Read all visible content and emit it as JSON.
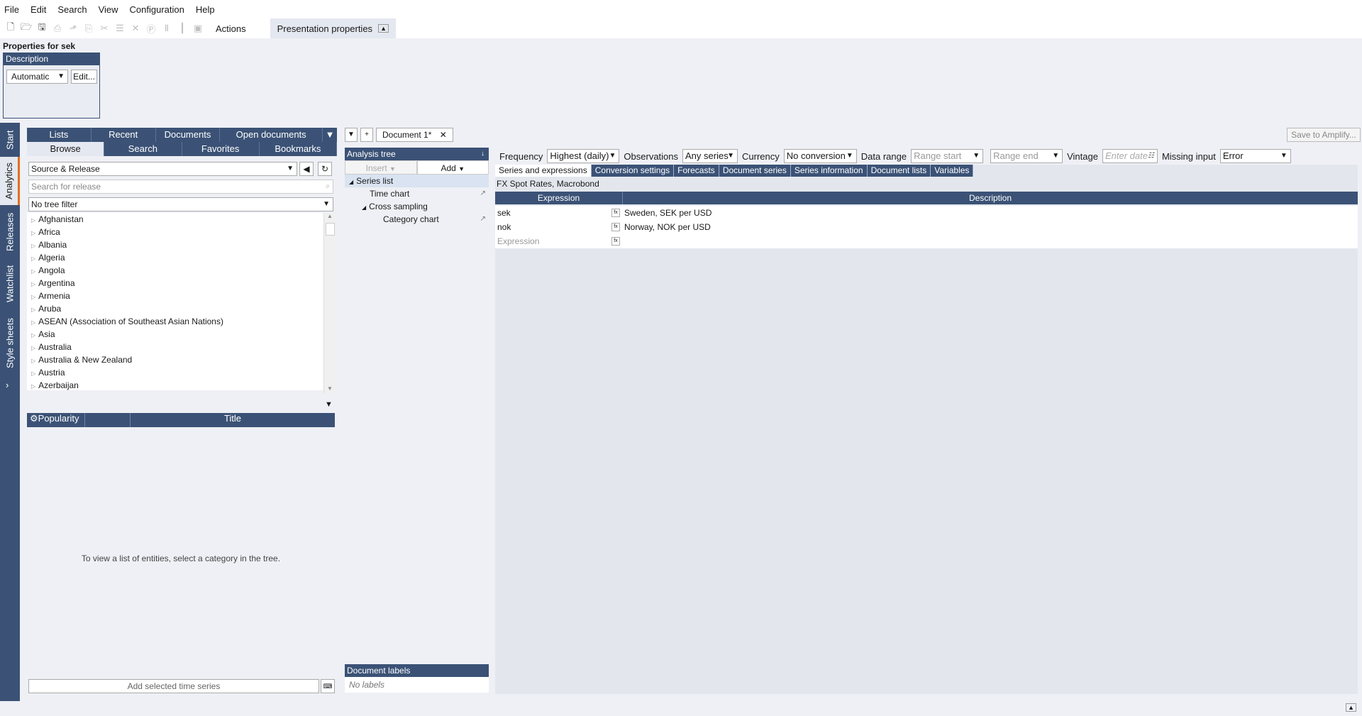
{
  "menu": [
    "File",
    "Edit",
    "Search",
    "View",
    "Configuration",
    "Help"
  ],
  "toolbar": {
    "actions_label": "Actions",
    "presentation_tab": "Presentation properties"
  },
  "properties": {
    "title": "Properties for sek",
    "description_header": "Description",
    "description_value": "Automatic",
    "edit_label": "Edit..."
  },
  "side_tabs": [
    "Start",
    "Analytics",
    "Releases",
    "Watchlist",
    "Style sheets"
  ],
  "browse": {
    "tabs_row1": [
      "Lists",
      "Recent",
      "Documents",
      "Open documents"
    ],
    "tabs_row2": [
      "Browse",
      "Search",
      "Favorites",
      "Bookmarks"
    ],
    "source_select": "Source & Release",
    "search_placeholder": "Search for release",
    "tree_filter": "No tree filter",
    "tree_items": [
      "Afghanistan",
      "Africa",
      "Albania",
      "Algeria",
      "Angola",
      "Argentina",
      "Armenia",
      "Aruba",
      "ASEAN (Association of Southeast Asian Nations)",
      "Asia",
      "Australia",
      "Australia & New Zealand",
      "Austria",
      "Azerbaijan"
    ],
    "grid_columns": [
      "Popularity",
      "",
      "Title"
    ],
    "empty_message": "To view a list of entities, select a category in the tree.",
    "add_selected": "Add selected time series"
  },
  "document": {
    "tab_label": "Document 1*",
    "save_amplify": "Save to Amplify..."
  },
  "analysis_tree": {
    "header": "Analysis tree",
    "insert_label": "Insert",
    "add_label": "Add",
    "items": [
      {
        "label": "Series list",
        "indent": 0
      },
      {
        "label": "Time chart",
        "indent": 1
      },
      {
        "label": "Cross sampling",
        "indent": 1
      },
      {
        "label": "Category chart",
        "indent": 2
      }
    ],
    "doc_labels_header": "Document labels",
    "doc_labels_empty": "No labels"
  },
  "options": {
    "frequency_label": "Frequency",
    "frequency_value": "Highest (daily)",
    "observations_label": "Observations",
    "observations_value": "Any series",
    "currency_label": "Currency",
    "currency_value": "No conversion",
    "data_range_label": "Data range",
    "range_start": "Range start",
    "range_end": "Range end",
    "vintage_label": "Vintage",
    "vintage_placeholder": "Enter date",
    "missing_label": "Missing input",
    "missing_value": "Error"
  },
  "sub_tabs": [
    "Series and expressions",
    "Conversion settings",
    "Forecasts",
    "Document series",
    "Series information",
    "Document lists",
    "Variables"
  ],
  "dataset_title": "FX Spot Rates, Macrobond",
  "expressions": {
    "columns": [
      "Expression",
      "Description"
    ],
    "rows": [
      {
        "expression": "sek",
        "description": "Sweden, SEK per USD"
      },
      {
        "expression": "nok",
        "description": "Norway, NOK per USD"
      }
    ],
    "new_placeholder": "Expression"
  }
}
